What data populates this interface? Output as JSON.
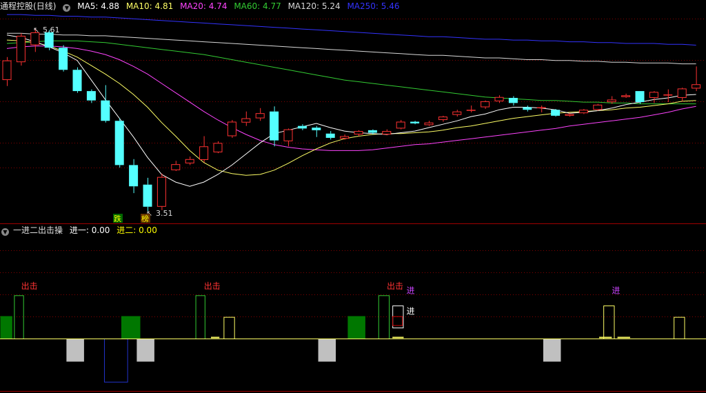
{
  "stock_name": "通程控股",
  "period": "(日线)",
  "ma_legend": [
    {
      "label": "MA5: 4.88",
      "color": "#ffffff"
    },
    {
      "label": "MA10: 4.81",
      "color": "#ffff66"
    },
    {
      "label": "MA20: 4.74",
      "color": "#ff44ff"
    },
    {
      "label": "MA60: 4.77",
      "color": "#33cc33"
    },
    {
      "label": "MA120: 5.24",
      "color": "#d8d8d8"
    },
    {
      "label": "MA250: 5.46",
      "color": "#3333ff"
    }
  ],
  "indicator": {
    "name": "一进二出击操",
    "legend": [
      {
        "label": "进一: 0.00",
        "color": "#ffffff"
      },
      {
        "label": "进二: 0.00",
        "color": "#ffff00"
      }
    ],
    "labels": {
      "chuji": "出击",
      "jin": "进"
    }
  },
  "chart_data": {
    "type": "candlestick",
    "price_markers": {
      "high": "5.61",
      "low": "3.51"
    },
    "signal_labels": [
      "跌",
      "榜"
    ],
    "colors": {
      "up": "#ff3232",
      "down": "#54ffff",
      "ma5": "#ffffff",
      "ma10": "#ffff66",
      "ma20": "#ff44ff",
      "ma60": "#33cc33",
      "ma120": "#d8d8d8",
      "ma250": "#3333ff"
    },
    "candles": [
      [
        5.05,
        5.28,
        4.98,
        5.32
      ],
      [
        5.26,
        5.57,
        5.22,
        5.6
      ],
      [
        5.46,
        5.61,
        5.38,
        5.66
      ],
      [
        5.61,
        5.43,
        5.4,
        5.64
      ],
      [
        5.43,
        5.17,
        5.15,
        5.46
      ],
      [
        5.17,
        4.92,
        4.9,
        5.2
      ],
      [
        4.92,
        4.81,
        4.78,
        4.94
      ],
      [
        4.81,
        4.57,
        4.55,
        4.99
      ],
      [
        4.57,
        4.05,
        4.02,
        4.6
      ],
      [
        4.05,
        3.8,
        3.72,
        4.12
      ],
      [
        3.82,
        3.56,
        3.51,
        3.9
      ],
      [
        3.56,
        3.91,
        3.52,
        3.95
      ],
      [
        3.99,
        4.06,
        3.98,
        4.1
      ],
      [
        4.07,
        4.12,
        4.05,
        4.15
      ],
      [
        4.11,
        4.27,
        4.08,
        4.39
      ],
      [
        4.2,
        4.31,
        4.19,
        4.33
      ],
      [
        4.39,
        4.56,
        4.37,
        4.58
      ],
      [
        4.55,
        4.6,
        4.51,
        4.68
      ],
      [
        4.6,
        4.66,
        4.57,
        4.72
      ],
      [
        4.68,
        4.34,
        4.27,
        4.74
      ],
      [
        4.33,
        4.47,
        4.27,
        4.48
      ],
      [
        4.51,
        4.48,
        4.46,
        4.53
      ],
      [
        4.49,
        4.46,
        4.38,
        4.51
      ],
      [
        4.42,
        4.37,
        4.35,
        4.45
      ],
      [
        4.36,
        4.39,
        4.35,
        4.41
      ],
      [
        4.41,
        4.45,
        4.39,
        4.46
      ],
      [
        4.46,
        4.43,
        4.41,
        4.47
      ],
      [
        4.41,
        4.45,
        4.4,
        4.47
      ],
      [
        4.48,
        4.56,
        4.47,
        4.58
      ],
      [
        4.56,
        4.54,
        4.53,
        4.57
      ],
      [
        4.52,
        4.55,
        4.51,
        4.57
      ],
      [
        4.58,
        4.62,
        4.56,
        4.63
      ],
      [
        4.64,
        4.68,
        4.62,
        4.7
      ],
      [
        4.69,
        4.7,
        4.67,
        4.75
      ],
      [
        4.73,
        4.8,
        4.71,
        4.81
      ],
      [
        4.8,
        4.85,
        4.78,
        4.87
      ],
      [
        4.84,
        4.78,
        4.75,
        4.86
      ],
      [
        4.73,
        4.7,
        4.68,
        4.75
      ],
      [
        4.73,
        4.73,
        4.67,
        4.75
      ],
      [
        4.7,
        4.63,
        4.62,
        4.71
      ],
      [
        4.63,
        4.65,
        4.62,
        4.66
      ],
      [
        4.66,
        4.7,
        4.65,
        4.71
      ],
      [
        4.7,
        4.76,
        4.69,
        4.77
      ],
      [
        4.79,
        4.82,
        4.77,
        4.86
      ],
      [
        4.85,
        4.87,
        4.84,
        4.89
      ],
      [
        4.92,
        4.79,
        4.77,
        4.92
      ],
      [
        4.84,
        4.91,
        4.78,
        4.92
      ],
      [
        4.87,
        4.88,
        4.79,
        4.94
      ],
      [
        4.84,
        4.95,
        4.8,
        4.96
      ],
      [
        4.95,
        5.0,
        4.92,
        5.21
      ]
    ],
    "ma": {
      "ma5": [
        5.58,
        5.55,
        5.5,
        5.44,
        5.37,
        5.28,
        5.05,
        4.82,
        4.6,
        4.38,
        4.14,
        3.94,
        3.85,
        3.8,
        3.85,
        3.94,
        4.05,
        4.18,
        4.31,
        4.42,
        4.46,
        4.5,
        4.54,
        4.49,
        4.45,
        4.43,
        4.42,
        4.41,
        4.43,
        4.45,
        4.49,
        4.53,
        4.57,
        4.62,
        4.65,
        4.7,
        4.73,
        4.73,
        4.72,
        4.7,
        4.66,
        4.67,
        4.69,
        4.72,
        4.76,
        4.79,
        4.82,
        4.84,
        4.87,
        4.88
      ],
      "ma10": [
        5.52,
        5.51,
        5.49,
        5.45,
        5.39,
        5.32,
        5.22,
        5.12,
        5.01,
        4.88,
        4.73,
        4.55,
        4.39,
        4.22,
        4.08,
        3.99,
        3.95,
        3.93,
        3.94,
        3.99,
        4.07,
        4.16,
        4.24,
        4.31,
        4.36,
        4.39,
        4.41,
        4.42,
        4.42,
        4.43,
        4.44,
        4.46,
        4.49,
        4.51,
        4.54,
        4.57,
        4.6,
        4.62,
        4.64,
        4.66,
        4.67,
        4.68,
        4.69,
        4.7,
        4.72,
        4.73,
        4.75,
        4.77,
        4.8,
        4.81
      ],
      "ma20": [
        5.42,
        5.44,
        5.45,
        5.45,
        5.44,
        5.42,
        5.39,
        5.35,
        5.29,
        5.21,
        5.12,
        5.01,
        4.9,
        4.79,
        4.68,
        4.58,
        4.49,
        4.41,
        4.34,
        4.29,
        4.26,
        4.24,
        4.23,
        4.22,
        4.22,
        4.22,
        4.23,
        4.25,
        4.27,
        4.29,
        4.3,
        4.32,
        4.34,
        4.36,
        4.38,
        4.4,
        4.42,
        4.44,
        4.46,
        4.48,
        4.51,
        4.53,
        4.55,
        4.57,
        4.59,
        4.61,
        4.64,
        4.67,
        4.71,
        4.74
      ],
      "ma60": [
        5.48,
        5.49,
        5.5,
        5.51,
        5.51,
        5.51,
        5.5,
        5.49,
        5.47,
        5.45,
        5.43,
        5.41,
        5.39,
        5.37,
        5.35,
        5.32,
        5.29,
        5.26,
        5.23,
        5.2,
        5.17,
        5.14,
        5.11,
        5.08,
        5.05,
        5.03,
        5.01,
        4.99,
        4.97,
        4.95,
        4.93,
        4.91,
        4.89,
        4.87,
        4.85,
        4.84,
        4.83,
        4.82,
        4.81,
        4.81,
        4.8,
        4.79,
        4.79,
        4.78,
        4.78,
        4.77,
        4.77,
        4.77,
        4.77,
        4.77
      ],
      "ma120": [
        5.6,
        5.6,
        5.59,
        5.59,
        5.58,
        5.58,
        5.57,
        5.57,
        5.56,
        5.55,
        5.54,
        5.53,
        5.52,
        5.51,
        5.5,
        5.49,
        5.48,
        5.47,
        5.46,
        5.45,
        5.44,
        5.43,
        5.42,
        5.41,
        5.4,
        5.39,
        5.38,
        5.37,
        5.36,
        5.35,
        5.34,
        5.34,
        5.33,
        5.32,
        5.31,
        5.31,
        5.3,
        5.29,
        5.29,
        5.28,
        5.28,
        5.27,
        5.27,
        5.26,
        5.26,
        5.25,
        5.25,
        5.25,
        5.24,
        5.24
      ],
      "ma250": [
        5.82,
        5.82,
        5.81,
        5.81,
        5.8,
        5.8,
        5.79,
        5.79,
        5.78,
        5.77,
        5.76,
        5.75,
        5.74,
        5.73,
        5.72,
        5.71,
        5.7,
        5.69,
        5.68,
        5.67,
        5.66,
        5.65,
        5.64,
        5.63,
        5.62,
        5.61,
        5.6,
        5.59,
        5.58,
        5.57,
        5.56,
        5.56,
        5.55,
        5.54,
        5.53,
        5.53,
        5.52,
        5.52,
        5.51,
        5.51,
        5.5,
        5.5,
        5.49,
        5.49,
        5.48,
        5.48,
        5.48,
        5.47,
        5.47,
        5.46
      ]
    },
    "indicator_bars": [
      {
        "start": 0,
        "end": 0.9,
        "value": 1.0,
        "style": "green"
      },
      {
        "start": 1,
        "end": 1.7,
        "value": 1.9,
        "style": "green-outline"
      },
      {
        "start": 4.7,
        "end": 6,
        "value": -1.0,
        "style": "gray"
      },
      {
        "start": 7.4,
        "end": 9.1,
        "value": -1.9,
        "style": "blue-outline"
      },
      {
        "start": 9.7,
        "end": 11,
        "value": -1.0,
        "style": "gray"
      },
      {
        "start": 8.6,
        "end": 10,
        "value": 1.0,
        "style": "green"
      },
      {
        "start": 13.9,
        "end": 14.6,
        "value": 1.9,
        "style": "green-outline"
      },
      {
        "start": 15.9,
        "end": 16.7,
        "value": 0.95,
        "style": "yellow-outline"
      },
      {
        "start": 22.6,
        "end": 23.9,
        "value": -1.0,
        "style": "gray"
      },
      {
        "start": 24.7,
        "end": 26,
        "value": 1.0,
        "style": "green"
      },
      {
        "start": 26.9,
        "end": 27.7,
        "value": 1.9,
        "style": "green-outline"
      },
      {
        "start": 27.9,
        "end": 28.7,
        "value": 1.45,
        "style": "white-outline"
      },
      {
        "start": 27.9,
        "end": 28.7,
        "value": 0.95,
        "style": "red-thin"
      },
      {
        "start": 38.6,
        "end": 39.9,
        "value": -1.0,
        "style": "gray"
      },
      {
        "start": 42.9,
        "end": 43.7,
        "value": 1.45,
        "style": "yellow-outline"
      },
      {
        "start": 47.9,
        "end": 48.7,
        "value": 0.95,
        "style": "yellow-outline"
      }
    ],
    "indicator_texts": [
      {
        "x": 1.5,
        "value": 2.3,
        "key": "chuji",
        "color": "#ff3333"
      },
      {
        "x": 14.5,
        "value": 2.3,
        "key": "chuji",
        "color": "#ff3333"
      },
      {
        "x": 27.5,
        "value": 2.3,
        "key": "chuji",
        "color": "#ff3333"
      },
      {
        "x": 28.9,
        "value": 2.1,
        "key": "jin",
        "color": "#cc44ff"
      },
      {
        "x": 28.9,
        "value": 1.2,
        "key": "jin",
        "color": "#ffffff"
      },
      {
        "x": 43.5,
        "value": 2.1,
        "key": "jin",
        "color": "#cc44ff"
      }
    ]
  }
}
